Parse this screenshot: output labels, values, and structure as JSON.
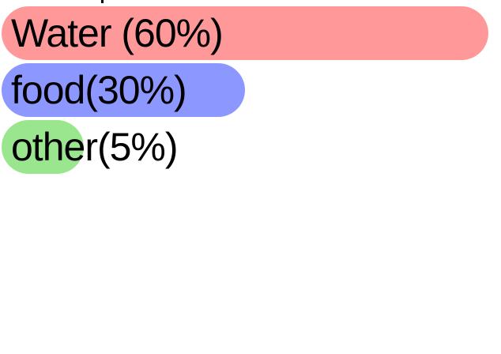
{
  "chart_data": {
    "type": "bar",
    "orientation": "horizontal",
    "categories": [
      "Water",
      "food",
      "other"
    ],
    "values": [
      60,
      30,
      5
    ],
    "labels": [
      "Water (60%)",
      "food(30%)",
      "other(5%)"
    ],
    "colors": [
      "#ff9999",
      "#8c97ff",
      "#99e68f"
    ],
    "unit": "%",
    "grid": false,
    "legend": "none"
  }
}
